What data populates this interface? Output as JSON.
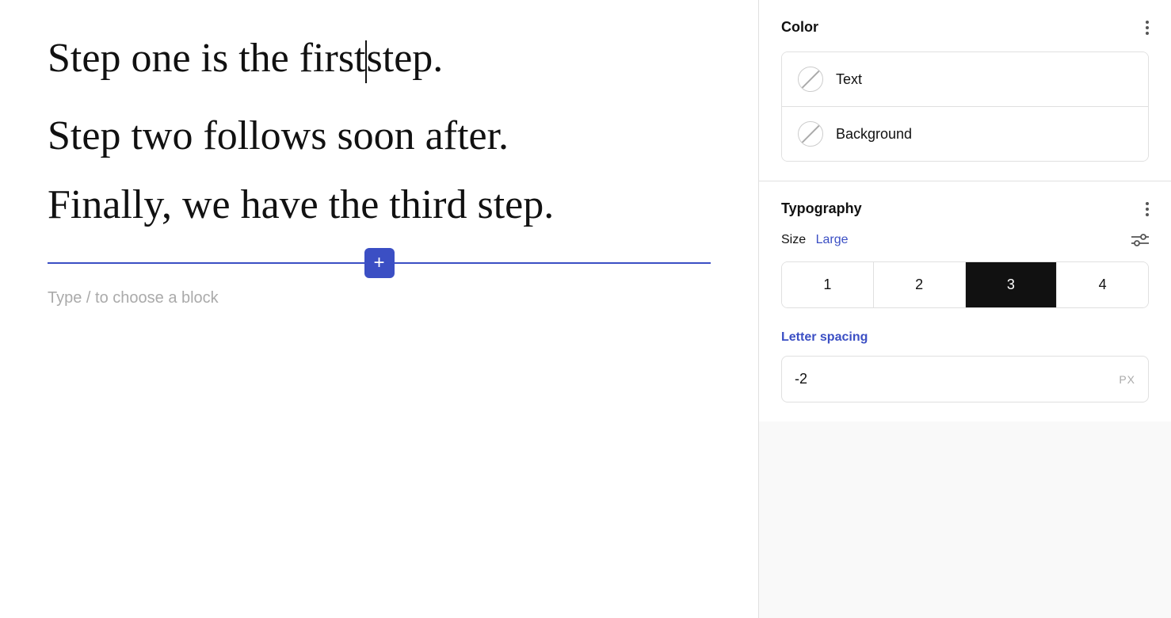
{
  "left": {
    "line1": "Step one is the first",
    "line1_end": "step.",
    "line2": "Step two follows soon after.",
    "line3": "Finally, we have the third step.",
    "placeholder": "Type / to choose a block"
  },
  "right": {
    "color_section": {
      "title": "Color",
      "items": [
        {
          "label": "Text"
        },
        {
          "label": "Background"
        }
      ]
    },
    "typography_section": {
      "title": "Typography",
      "size_label": "Size",
      "size_value": "Large",
      "size_buttons": [
        "1",
        "2",
        "3",
        "4"
      ],
      "active_size_index": 2,
      "letter_spacing_label": "Letter spacing",
      "letter_spacing_value": "-2",
      "letter_spacing_unit": "PX"
    }
  }
}
